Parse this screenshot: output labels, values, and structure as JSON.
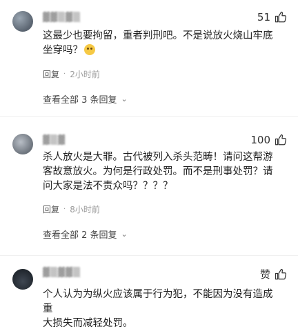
{
  "comments": [
    {
      "username": "▓▓▒▓▒",
      "likes": "51",
      "text_line1": "这最少也要拘留，重者判刑吧。不是说放火烧山牢底",
      "text_line2": "坐穿吗？",
      "emoji": "thinking-emoji",
      "reply": "回复",
      "time": "2小时前",
      "view_replies": "查看全部 3 条回复"
    },
    {
      "username": "▓▒▓",
      "likes": "100",
      "text_line1": "杀人放火是大罪。古代被列入杀头范畴！请问这帮游",
      "text_line2": "客故意放火。为何是行政处罚。而不是刑事处罚？请",
      "text_line3": "问大家是法不责众吗？？？？",
      "reply": "回复",
      "time": "8小时前",
      "view_replies": "查看全部 2 条回复"
    },
    {
      "username": "▓▒▓▓▒",
      "likes": "赞",
      "text_line1": "个人认为为纵火应该属于行为犯，不能因为没有造成重",
      "text_line2": "大损失而减轻处罚。"
    }
  ],
  "icons": {
    "like": "thumbs-up-icon",
    "chevron": "chevron-down-icon"
  }
}
